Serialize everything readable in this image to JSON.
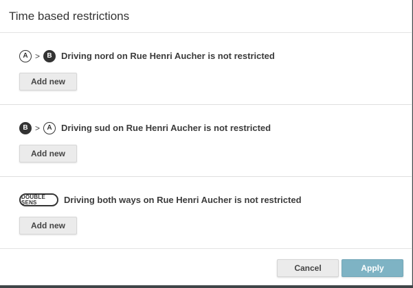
{
  "dialog": {
    "title": "Time based restrictions",
    "restrictions": [
      {
        "from": "A",
        "to": "B",
        "description": "Driving nord on Rue Henri Aucher is not restricted",
        "add_label": "Add new"
      },
      {
        "from": "B",
        "to": "A",
        "description": "Driving sud on Rue Henri Aucher is not restricted",
        "add_label": "Add new"
      },
      {
        "badge_line1": "DOUBLE",
        "badge_line2": "SENS",
        "description": "Driving both ways on Rue Henri Aucher is not restricted",
        "add_label": "Add new"
      }
    ],
    "separator": ">",
    "cancel_label": "Cancel",
    "apply_label": "Apply"
  },
  "colors": {
    "apply_button": "#7eb3c4",
    "badge_dark": "#333333"
  }
}
